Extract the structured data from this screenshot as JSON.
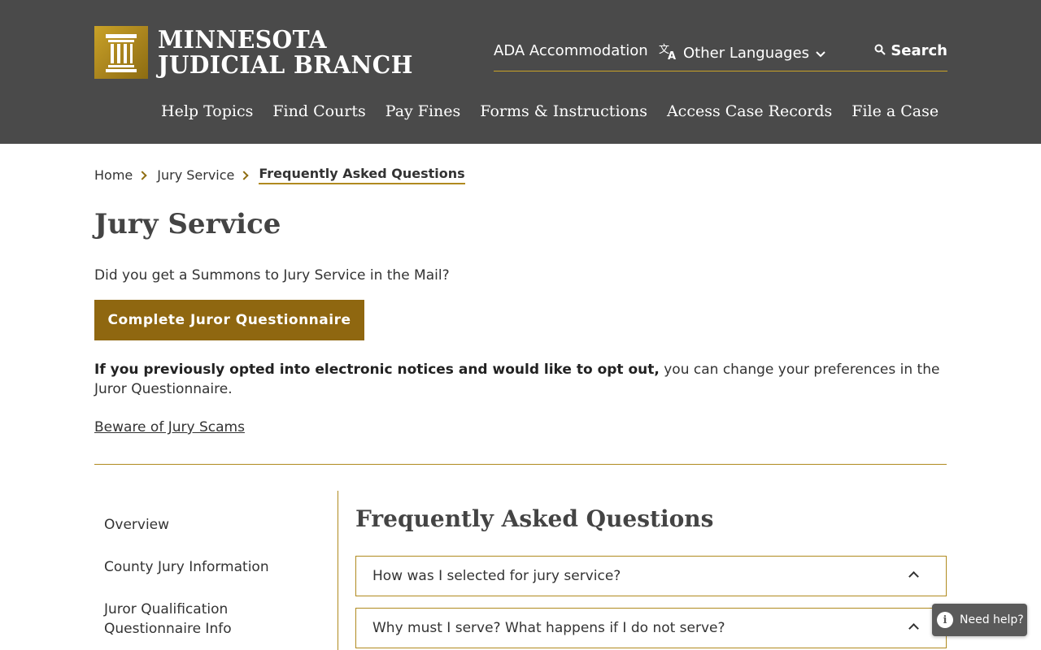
{
  "header": {
    "logo_line1": "MINNESOTA",
    "logo_line2": "JUDICIAL BRANCH",
    "utility": {
      "ada": "ADA Accommodation",
      "languages": "Other Languages",
      "search": "Search"
    },
    "nav": [
      "Help Topics",
      "Find Courts",
      "Pay Fines",
      "Forms & Instructions",
      "Access Case Records",
      "File a Case"
    ]
  },
  "breadcrumb": [
    "Home",
    "Jury Service",
    "Frequently Asked Questions"
  ],
  "page_title": "Jury Service",
  "summons_text": "Did you get a Summons to Jury Service in the Mail?",
  "questionnaire_button": "Complete Juror Questionnaire",
  "optout": {
    "bold": "If you previously opted into electronic notices and would like to opt out,",
    "text": " you can change your preferences in the ",
    "link": "Juror Questionnaire",
    "end": "."
  },
  "scams_link": "Beware of Jury Scams",
  "sidebar": [
    "Overview",
    "County Jury Information",
    "Juror Qualification Questionnaire Info"
  ],
  "faq": {
    "title": "Frequently Asked Questions",
    "items": [
      "How was I selected for jury service?",
      "Why must I serve? What happens if I do not serve?"
    ]
  },
  "help_widget": "Need help?",
  "colors": {
    "header_bg": "#4a4a4a",
    "gold": "#8f6710",
    "accent_line": "#b08a1f"
  }
}
